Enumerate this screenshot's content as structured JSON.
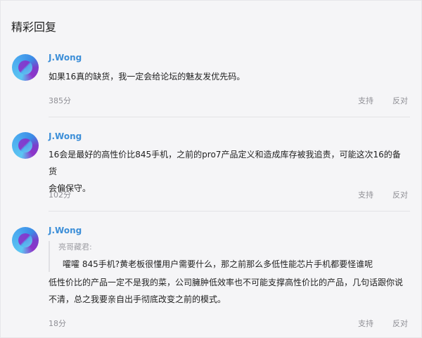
{
  "section": {
    "title": "精彩回复"
  },
  "replies": [
    {
      "user": "J.Wong",
      "content": "如果16真的缺货，我一定会给论坛的魅友发优先码。",
      "score": "385分",
      "support_label": "支持",
      "oppose_label": "反对"
    },
    {
      "user": "J.Wong",
      "content_line1": "16会是最好的高性价比845手机，之前的pro7产品定义和造成库存被我追责，可能这次16的备货",
      "content_line2": "会偏保守。",
      "score": "102分",
      "support_label": "支持",
      "oppose_label": "反对"
    },
    {
      "user": "J.Wong",
      "quote_author": "亮哥藏君:",
      "quote_text": "嚯嚯 845手机?黄老板很懂用户需要什么，那之前那么多低性能芯片手机都要怪谁呢",
      "content_line1": "低性价比的产品一定不是我的菜，公司臃肿低效率也不可能支撑高性价比的产品，几句话跟你说",
      "content_line2": "不清，总之我要亲自出手彻底改变之前的模式。",
      "score": "18分",
      "support_label": "支持",
      "oppose_label": "反对"
    }
  ]
}
